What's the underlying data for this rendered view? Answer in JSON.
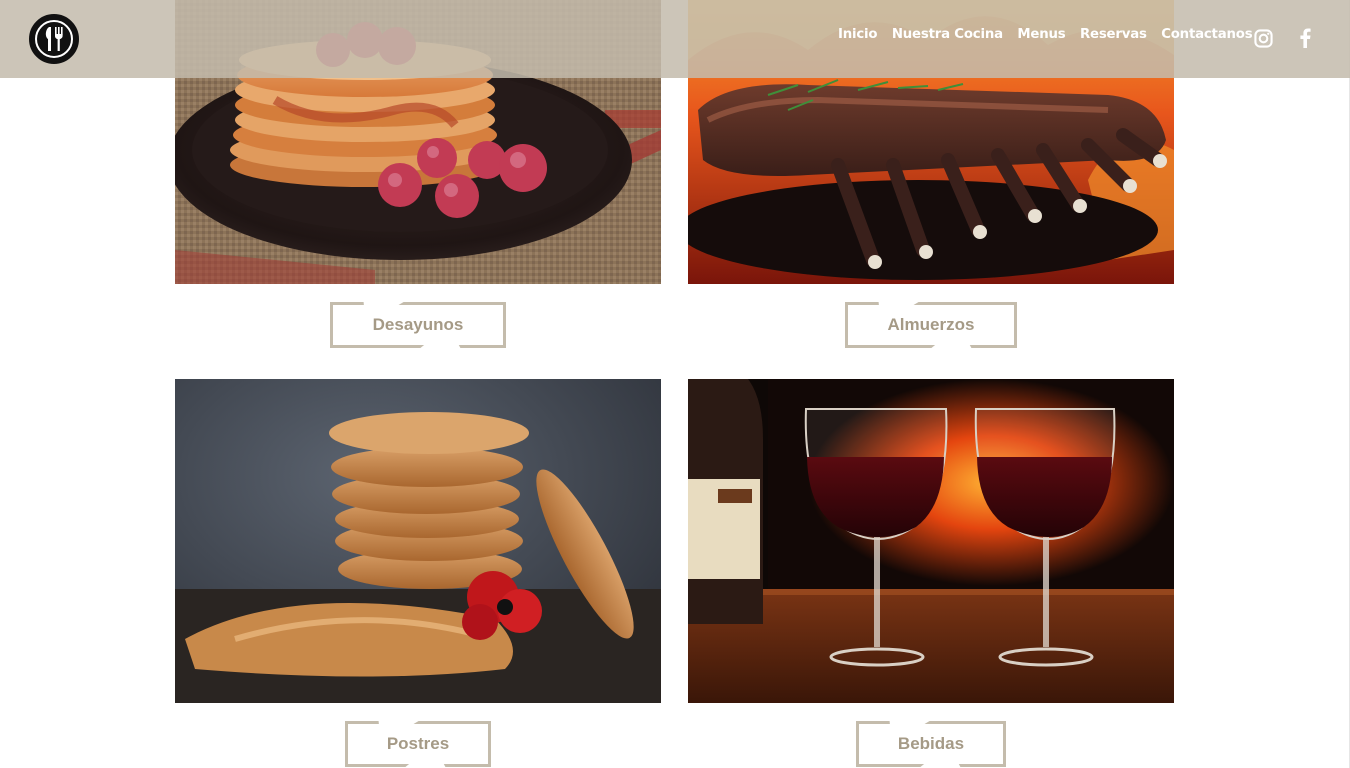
{
  "nav": {
    "items": [
      "Inicio",
      "Nuestra Cocina",
      "Menus",
      "Reservas",
      "Contactanos"
    ]
  },
  "social": {
    "instagram_icon": "instagram-icon",
    "facebook_icon": "facebook-icon"
  },
  "logo_icon": "fork-knife-icon",
  "colors": {
    "header_bg": "#c4bcac",
    "button_border": "#c4bcac",
    "button_text": "#a59a86"
  },
  "menu": {
    "cards": [
      {
        "label": "Desayunos",
        "image": "pancakes-with-raspberries"
      },
      {
        "label": "Almuerzos",
        "image": "grilled-rack-of-ribs"
      },
      {
        "label": "Postres",
        "image": "stack-of-oat-cookies"
      },
      {
        "label": "Bebidas",
        "image": "two-glasses-of-red-wine"
      }
    ]
  }
}
